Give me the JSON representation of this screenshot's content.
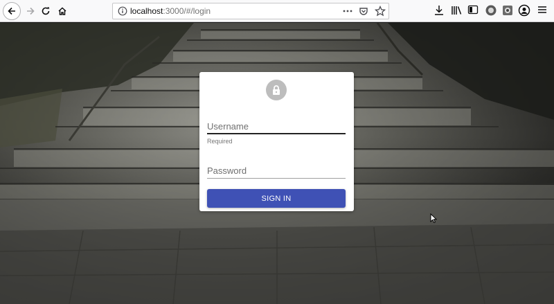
{
  "browser": {
    "url_host": "localhost",
    "url_path": ":3000/#/login",
    "icons": {
      "back": "back-arrow-icon",
      "forward": "forward-arrow-icon",
      "reload": "reload-icon",
      "home": "home-icon",
      "site_info": "info-icon",
      "page_actions": "ellipsis-icon",
      "pocket": "pocket-icon",
      "bookmark": "star-icon",
      "downloads": "download-icon",
      "library": "library-icon",
      "sidebar": "sidebar-icon",
      "menu": "hamburger-menu-icon"
    }
  },
  "login": {
    "avatar_icon": "lock-icon",
    "username": {
      "placeholder": "Username",
      "value": "",
      "helper": "Required"
    },
    "password": {
      "placeholder": "Password",
      "value": ""
    },
    "submit_label": "SIGN IN"
  },
  "colors": {
    "primary": "#3f51b5",
    "card": "#ffffff",
    "avatar": "#bdbdbd"
  }
}
